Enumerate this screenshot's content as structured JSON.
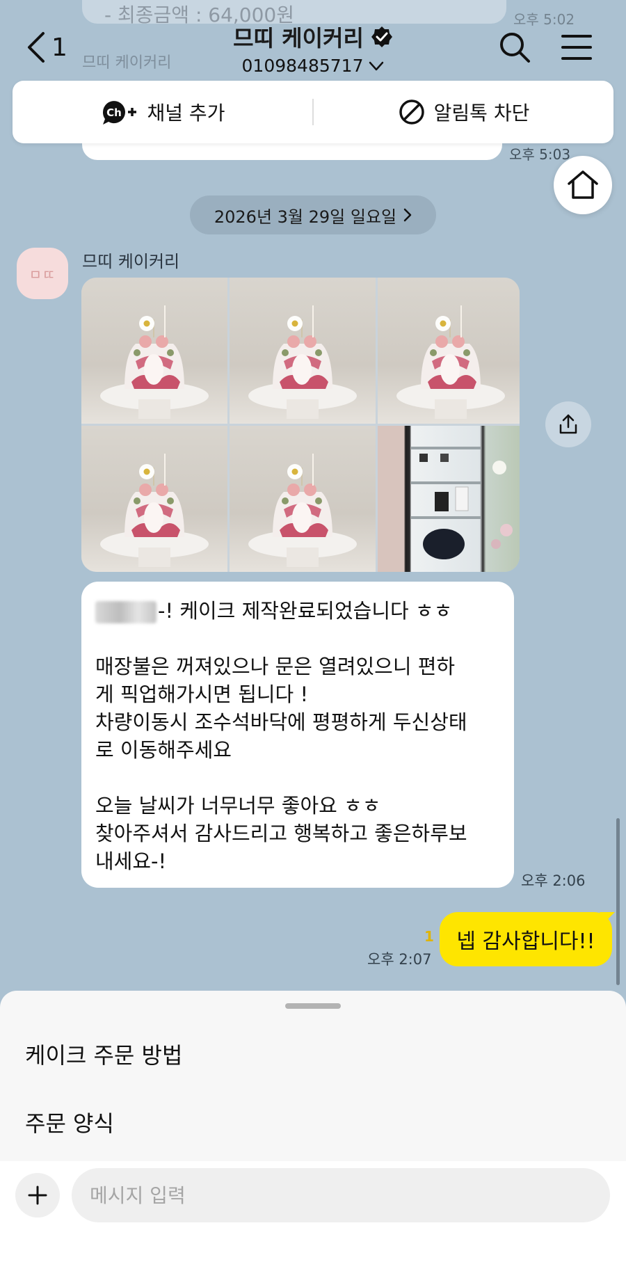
{
  "ghost": {
    "text": "- 최종금액 : 64,000원",
    "time": "오후 5:02",
    "sender": "므띠 케이커리"
  },
  "header": {
    "back_count": "1",
    "title": "므띠 케이커리",
    "phone": "01098485717"
  },
  "channel_bar": {
    "add_channel": "채널 추가",
    "block_alert": "알림톡 차단"
  },
  "prev_message": {
    "time": "오후 5:03"
  },
  "date_divider": "2026년 3월 29일 일요일",
  "sender": {
    "name": "므띠 케이커리",
    "avatar_text": "ㅁㄸ"
  },
  "photos": [
    {
      "name": "cake-photo-1"
    },
    {
      "name": "cake-photo-2"
    },
    {
      "name": "cake-photo-3"
    },
    {
      "name": "cake-photo-4"
    },
    {
      "name": "cake-photo-5"
    },
    {
      "name": "fridge-photo"
    }
  ],
  "received_message": {
    "first_line_suffix": "-! 케이크 제작완료되었습니다 ㅎㅎ",
    "lines": [
      "",
      "매장불은 꺼져있으나 문은 열려있으니 편하",
      "게 픽업해가시면 됩니다 !",
      "차량이동시 조수석바닥에 평평하게 두신상태",
      "로 이동해주세요",
      "",
      "오늘 날씨가 너무너무 좋아요 ㅎㅎ",
      "찾아주셔서 감사드리고 행복하고 좋은하루보",
      "내세요-!"
    ],
    "time": "오후 2:06"
  },
  "sent_message": {
    "text": "넵 감사합니다!!",
    "unread": "1",
    "time": "오후 2:07"
  },
  "menu": {
    "items": [
      "케이크 주문 방법",
      "주문 양식"
    ]
  },
  "input": {
    "placeholder": "메시지 입력",
    "value": ""
  },
  "colors": {
    "chat_bg": "#abc1d1",
    "sent_bubble": "#fee500",
    "received_bubble": "#ffffff",
    "unread": "#e0b400"
  },
  "icons": [
    "chevron-left-icon",
    "verified-badge-icon",
    "chevron-down-icon",
    "search-icon",
    "menu-icon",
    "channel-add-icon",
    "block-icon",
    "home-icon",
    "chevron-right-icon",
    "share-icon",
    "plus-icon"
  ]
}
